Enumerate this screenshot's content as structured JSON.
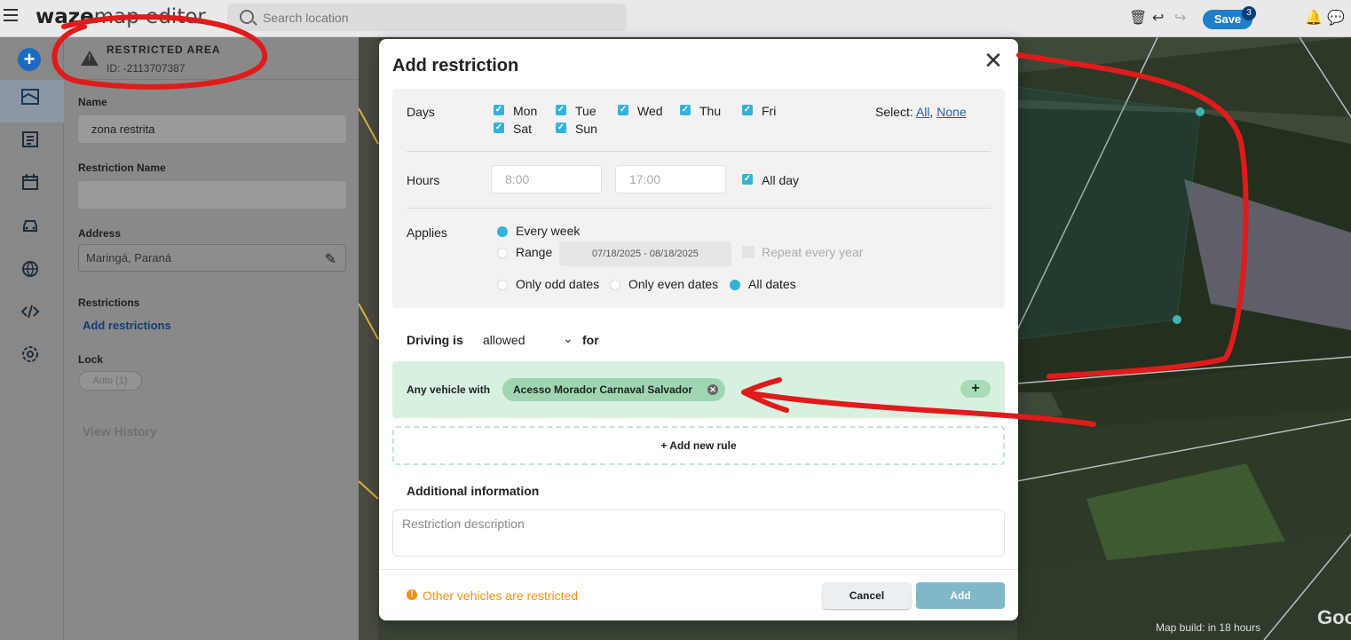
{
  "topbar": {
    "logo_bold": "waze",
    "logo_rest": "map editor",
    "search_placeholder": "Search location",
    "save_label": "Save",
    "save_count": "3"
  },
  "rail": {
    "icons": [
      "add-icon",
      "map-layers-icon",
      "list-icon",
      "calendar-icon",
      "car-icon",
      "globe-icon",
      "code-icon",
      "settings-icon"
    ]
  },
  "panel": {
    "type_label": "RESTRICTED AREA",
    "id_label": "ID: -2113707387",
    "name_label": "Name",
    "name_value": "zona restrita",
    "restriction_name_label": "Restriction Name",
    "restriction_name_value": "",
    "address_label": "Address",
    "address_value": "Maringá, Paraná",
    "restrictions_label": "Restrictions",
    "add_restrictions": "Add restrictions",
    "lock_label": "Lock",
    "lock_value": "Auto (1)",
    "view_history": "View History"
  },
  "modal": {
    "title": "Add restriction",
    "days_label": "Days",
    "days": [
      {
        "label": "Mon",
        "checked": true
      },
      {
        "label": "Tue",
        "checked": true
      },
      {
        "label": "Wed",
        "checked": true
      },
      {
        "label": "Thu",
        "checked": true
      },
      {
        "label": "Fri",
        "checked": true
      },
      {
        "label": "Sat",
        "checked": true
      },
      {
        "label": "Sun",
        "checked": true
      }
    ],
    "select_prefix": "Select:",
    "select_all": "All",
    "select_sep": ",",
    "select_none": "None",
    "hours_label": "Hours",
    "hours_from_placeholder": "8:00",
    "hours_to_placeholder": "17:00",
    "all_day": "All day",
    "applies_label": "Applies",
    "every_week": "Every week",
    "range": "Range",
    "date_range": "07/18/2025 - 08/18/2025",
    "repeat_every_year": "Repeat every year",
    "only_odd": "Only odd dates",
    "only_even": "Only even dates",
    "all_dates": "All dates",
    "driving_is": "Driving is",
    "driving_value": "allowed",
    "for_label": "for",
    "rule_prefix": "Any vehicle with",
    "rule_chip": "Acesso Morador Carnaval Salvador",
    "add_new_rule": "+ Add new rule",
    "additional_info": "Additional information",
    "description_placeholder": "Restriction description",
    "warning": "Other vehicles are restricted",
    "cancel": "Cancel",
    "add": "Add"
  },
  "map": {
    "build_text": "Map build: in 18 hours",
    "google_text": "Goo"
  },
  "colors": {
    "accent": "#33b3d9",
    "save_blue": "#1e7fcb",
    "rule_green": "#d8f0df",
    "warning": "#f29111",
    "annotation_red": "#e01b1b"
  }
}
